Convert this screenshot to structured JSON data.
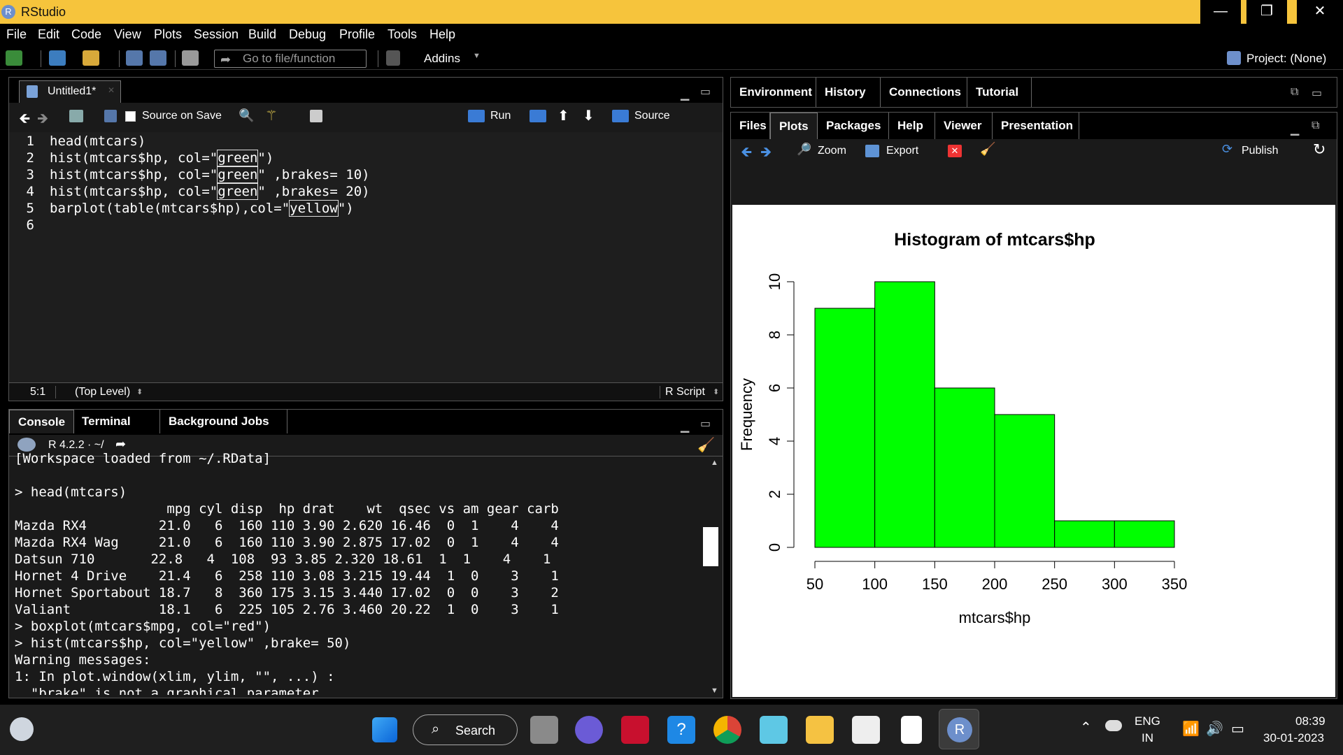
{
  "window": {
    "title": "RStudio",
    "logo": "R",
    "buttons": [
      "—",
      "❐",
      "✕"
    ]
  },
  "menu": [
    "File",
    "Edit",
    "Code",
    "View",
    "Plots",
    "Session",
    "Build",
    "Debug",
    "Profile",
    "Tools",
    "Help"
  ],
  "toolbar": {
    "goto_placeholder": "Go to file/function",
    "addins": "Addins",
    "project": "Project: (None)"
  },
  "editor": {
    "tab": "Untitled1*",
    "source_on_save": "Source on Save",
    "run": "Run",
    "source": "Source",
    "lines": [
      {
        "n": "1",
        "parts": [
          {
            "t": "head(mtcars)"
          }
        ]
      },
      {
        "n": "2",
        "parts": [
          {
            "t": "hist(mtcars$hp, col=\""
          },
          {
            "t": "green",
            "box": true
          },
          {
            "t": "\")"
          }
        ]
      },
      {
        "n": "3",
        "parts": [
          {
            "t": "hist(mtcars$hp, col=\""
          },
          {
            "t": "green",
            "box": true
          },
          {
            "t": "\" ,brakes= 10)"
          }
        ]
      },
      {
        "n": "4",
        "parts": [
          {
            "t": "hist(mtcars$hp, col=\""
          },
          {
            "t": "green",
            "box": true
          },
          {
            "t": "\" ,brakes= 20)"
          }
        ]
      },
      {
        "n": "5",
        "parts": [
          {
            "t": "barplot(table(mtcars$hp),col=\""
          },
          {
            "t": "yellow",
            "box": true
          },
          {
            "t": "\")"
          }
        ]
      },
      {
        "n": "6",
        "parts": [
          {
            "t": ""
          }
        ]
      }
    ],
    "status_pos": "5:1",
    "status_scope": "(Top Level)",
    "status_type": "R Script"
  },
  "console": {
    "tabs": [
      "Console",
      "Terminal",
      "Background Jobs"
    ],
    "version": "R 4.2.2 · ~/",
    "lines": [
      "[Workspace loaded from ~/.RData]",
      "",
      "> head(mtcars)",
      "                   mpg cyl disp  hp drat    wt  qsec vs am gear carb",
      "Mazda RX4         21.0   6  160 110 3.90 2.620 16.46  0  1    4    4",
      "Mazda RX4 Wag     21.0   6  160 110 3.90 2.875 17.02  0  1    4    4",
      "Datsun 710       22.8   4  108  93 3.85 2.320 18.61  1  1    4    1",
      "Hornet 4 Drive    21.4   6  258 110 3.08 3.215 19.44  1  0    3    1",
      "Hornet Sportabout 18.7   8  360 175 3.15 3.440 17.02  0  0    3    2",
      "Valiant           18.1   6  225 105 2.76 3.460 20.22  1  0    3    1",
      "> boxplot(mtcars$mpg, col=\"red\")",
      "> hist(mtcars$hp, col=\"yellow\" ,brake= 50)",
      "Warning messages:",
      "1: In plot.window(xlim, ylim, \"\", ...) :",
      "  \"brake\" is not a graphical parameter"
    ]
  },
  "env_tabs": [
    "Environment",
    "History",
    "Connections",
    "Tutorial"
  ],
  "files_tabs": [
    "Files",
    "Plots",
    "Packages",
    "Help",
    "Viewer",
    "Presentation"
  ],
  "plot_toolbar": {
    "zoom": "Zoom",
    "export": "Export",
    "publish": "Publish"
  },
  "chart_data": {
    "type": "bar",
    "title": "Histogram of mtcars$hp",
    "xlabel": "mtcars$hp",
    "ylabel": "Frequency",
    "bins": [
      [
        50,
        100
      ],
      [
        100,
        150
      ],
      [
        150,
        200
      ],
      [
        200,
        250
      ],
      [
        250,
        300
      ],
      [
        300,
        350
      ]
    ],
    "values": [
      9,
      10,
      6,
      5,
      1,
      1
    ],
    "xticks": [
      "50",
      "100",
      "150",
      "200",
      "250",
      "300",
      "350"
    ],
    "yticks": [
      "0",
      "2",
      "4",
      "6",
      "8",
      "10"
    ],
    "xlim": [
      50,
      350
    ],
    "ylim": [
      0,
      10
    ],
    "bar_color": "#00ff00"
  },
  "taskbar": {
    "search": "Search",
    "lang1": "ENG",
    "lang2": "IN",
    "time": "08:39",
    "date": "30-01-2023"
  }
}
